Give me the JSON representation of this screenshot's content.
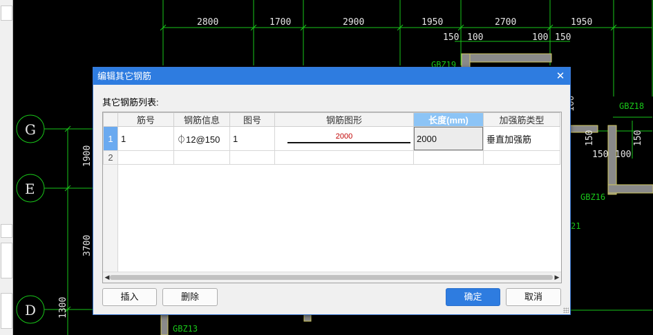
{
  "cad": {
    "top_dims": [
      "2800",
      "1700",
      "2900",
      "1950",
      "2700",
      "1950"
    ],
    "sub_dims": [
      "150",
      "100",
      "100",
      "150"
    ],
    "right_dims": [
      "150",
      "100",
      "100",
      "150",
      "150"
    ],
    "left_dims": [
      "1900",
      "3700",
      "1300"
    ],
    "grid_axes": [
      "G",
      "E",
      "D"
    ],
    "labels": [
      "GBZ19",
      "GBZ18",
      "GBZ16",
      "GBZ13",
      "21"
    ]
  },
  "dialog": {
    "title": "编辑其它钢筋",
    "list_label": "其它钢筋列表:",
    "columns": [
      "筋号",
      "钢筋信息",
      "图号",
      "钢筋图形",
      "长度(mm)",
      "加强筋类型"
    ],
    "selected_column": "长度(mm)",
    "rows": [
      {
        "index": "1",
        "bar_no": "1",
        "rebar_info": "⏀12@150",
        "figure_no": "1",
        "shape_value": "2000",
        "length": "2000",
        "type": "垂直加强筋"
      },
      {
        "index": "2",
        "bar_no": "",
        "rebar_info": "",
        "figure_no": "",
        "shape_value": "",
        "length": "",
        "type": ""
      }
    ],
    "buttons": {
      "insert": "插入",
      "delete": "删除",
      "ok": "确定",
      "cancel": "取消"
    }
  }
}
